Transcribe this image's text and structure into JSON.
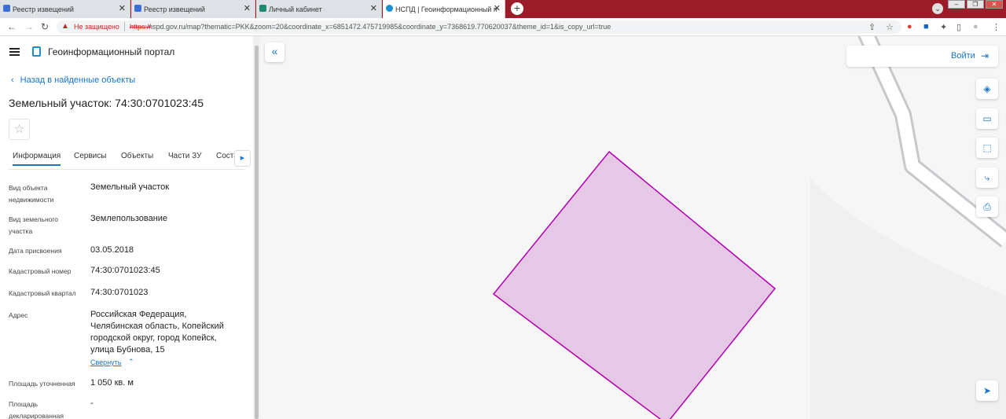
{
  "browser": {
    "tabs": [
      {
        "title": "Реестр извещений",
        "active": false
      },
      {
        "title": "Реестр извещений",
        "active": false
      },
      {
        "title": "Личный кабинет",
        "active": false
      },
      {
        "title": "НСПД | Геоинформационный п",
        "active": true
      }
    ],
    "new_tab": "+",
    "security_label": "Не защищено",
    "url_scheme": "https://",
    "url_rest": "nspd.gov.ru/map?thematic=PKK&zoom=20&coordinate_x=6851472.475719985&coordinate_y=7368619.770620037&theme_id=1&is_copy_url=true"
  },
  "portal": {
    "name": "Геоинформационный портал",
    "back_link": "Назад в найденные объекты",
    "object_title": "Земельный участок: 74:30:0701023:45",
    "tabs": [
      "Информация",
      "Сервисы",
      "Объекты",
      "Части ЗУ",
      "Соста"
    ],
    "fields": [
      {
        "label": "Вид объекта недвижимости",
        "value": "Земельный участок"
      },
      {
        "label": "Вид земельного участка",
        "value": "Землепользование"
      },
      {
        "label": "Дата присвоения",
        "value": "03.05.2018"
      },
      {
        "label": "Кадастровый номер",
        "value": "74:30:0701023:45"
      },
      {
        "label": "Кадастровый квартал",
        "value": "74:30:0701023"
      },
      {
        "label": "Адрес",
        "value": "Российская Федерация, Челябинская область, Копейский городской округ, город Копейск, улица Бубнова, 15"
      },
      {
        "label": "Площадь уточненная",
        "value": "1 050 кв. м"
      },
      {
        "label": "Площадь декларированная",
        "value": "-"
      }
    ],
    "collapse_link": "Свернуть"
  },
  "map": {
    "login_label": "Войти",
    "parcel_fill": "#e6c8e6",
    "parcel_stroke": "#b000b0"
  }
}
